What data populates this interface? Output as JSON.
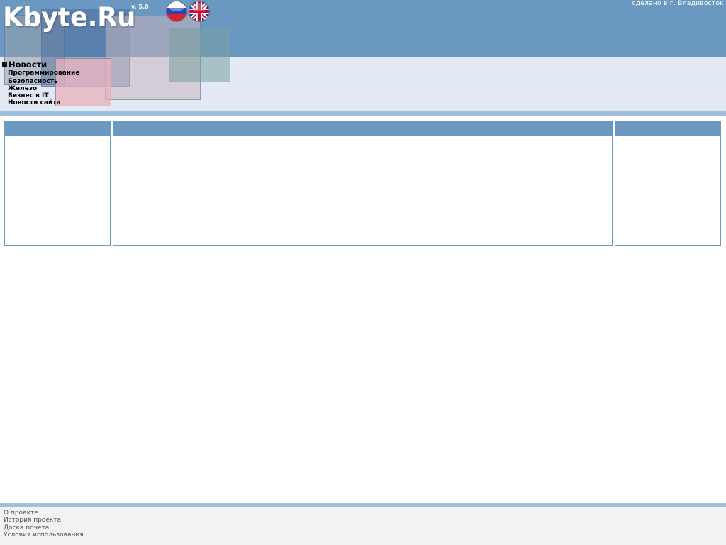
{
  "header": {
    "logo": "Kbyte.Ru",
    "version": "v. 5.0",
    "made_in": "сделано в г. Владивосток",
    "languages": [
      {
        "code": "ru",
        "icon": "russian-flag-icon"
      },
      {
        "code": "en",
        "icon": "uk-flag-icon"
      }
    ]
  },
  "nav": {
    "primary": "Новости",
    "items": [
      "Программирование",
      "Безопасность",
      "Железо",
      "Бизнес в IT",
      "Новости сайта"
    ]
  },
  "colors": {
    "header_blue": "#6b98c1",
    "nav_background": "#e2e8f4",
    "stripe": "#9fc0dc",
    "footer_background": "#f2f2f2"
  },
  "footer": {
    "links": [
      "О проекте",
      "История проекта",
      "Доска почета",
      "Условия использования"
    ]
  }
}
